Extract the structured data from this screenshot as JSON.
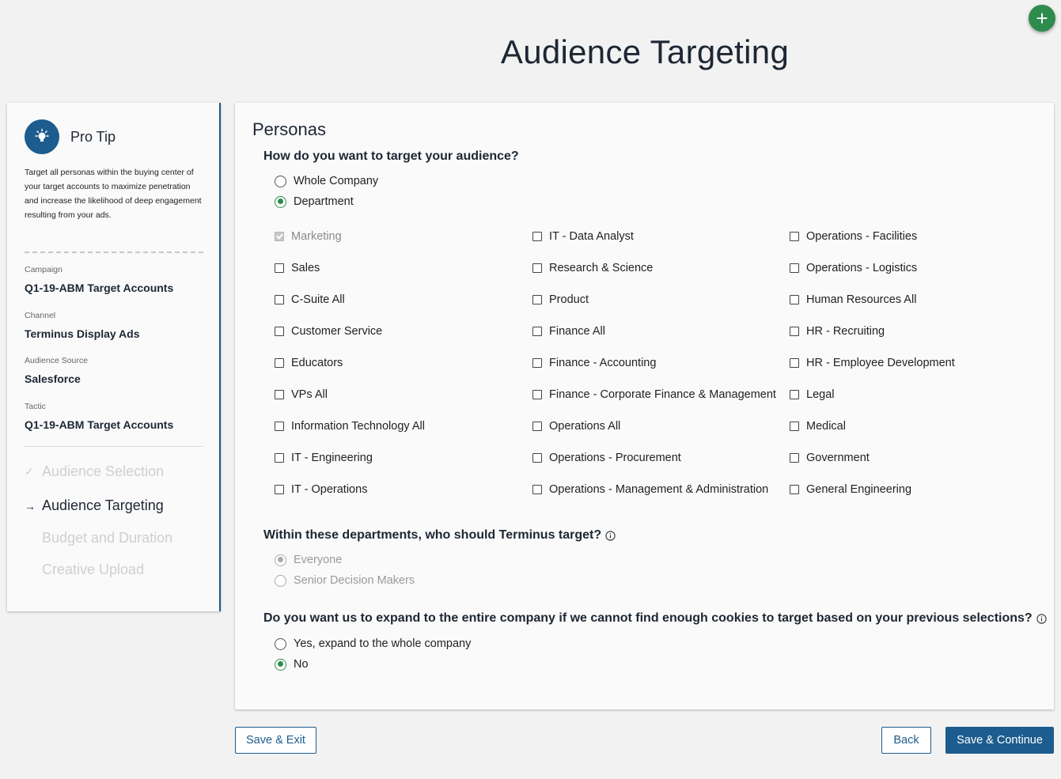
{
  "title": "Audience Targeting",
  "fab": {
    "icon": "plus-icon",
    "glyph": "+"
  },
  "sidebar": {
    "tip_title": "Pro Tip",
    "tip_icon": "lightbulb-icon",
    "tip_text": "Target all personas within the buying center of your target accounts to maximize penetration and increase the likelihood of deep engagement resulting from your ads.",
    "meta": [
      {
        "label": "Campaign",
        "value": "Q1-19-ABM Target Accounts"
      },
      {
        "label": "Channel",
        "value": "Terminus Display Ads"
      },
      {
        "label": "Audience Source",
        "value": "Salesforce"
      },
      {
        "label": "Tactic",
        "value": "Q1-19-ABM Target Accounts"
      }
    ],
    "steps": [
      {
        "label": "Audience Selection",
        "state": "done",
        "marker": "✓"
      },
      {
        "label": "Audience Targeting",
        "state": "active",
        "marker": "→"
      },
      {
        "label": "Budget and Duration",
        "state": "upcoming",
        "marker": ""
      },
      {
        "label": "Creative Upload",
        "state": "upcoming",
        "marker": ""
      }
    ]
  },
  "main": {
    "heading": "Personas",
    "q1": {
      "text": "How do you want to target your audience?",
      "options": [
        {
          "label": "Whole Company",
          "checked": false
        },
        {
          "label": "Department",
          "checked": true
        }
      ]
    },
    "departments": [
      [
        {
          "label": "Marketing",
          "checked": true,
          "disabled": true
        },
        {
          "label": "Sales"
        },
        {
          "label": "C-Suite All"
        },
        {
          "label": "Customer Service"
        },
        {
          "label": "Educators"
        },
        {
          "label": "VPs All"
        },
        {
          "label": "Information Technology All"
        },
        {
          "label": "IT - Engineering"
        },
        {
          "label": "IT - Operations"
        }
      ],
      [
        {
          "label": "IT - Data Analyst"
        },
        {
          "label": "Research & Science"
        },
        {
          "label": "Product"
        },
        {
          "label": "Finance All"
        },
        {
          "label": "Finance - Accounting"
        },
        {
          "label": "Finance - Corporate Finance & Management"
        },
        {
          "label": "Operations All"
        },
        {
          "label": "Operations - Procurement"
        },
        {
          "label": "Operations - Management & Administration"
        }
      ],
      [
        {
          "label": "Operations - Facilities"
        },
        {
          "label": "Operations - Logistics"
        },
        {
          "label": "Human Resources All"
        },
        {
          "label": "HR - Recruiting"
        },
        {
          "label": "HR - Employee Development"
        },
        {
          "label": "Legal"
        },
        {
          "label": "Medical"
        },
        {
          "label": "Government"
        },
        {
          "label": "General Engineering"
        }
      ]
    ],
    "q2": {
      "text": "Within these departments, who should Terminus target?",
      "options": [
        {
          "label": "Everyone",
          "checked": true,
          "disabled": true
        },
        {
          "label": "Senior Decision Makers",
          "checked": false,
          "disabled": true
        }
      ]
    },
    "q3": {
      "text": "Do you want us to expand to the entire company if we cannot find enough cookies to target based on your previous selections?",
      "options": [
        {
          "label": "Yes, expand to the whole company",
          "checked": false
        },
        {
          "label": "No",
          "checked": true
        }
      ]
    }
  },
  "buttons": {
    "save_exit": "Save & Exit",
    "back": "Back",
    "save_continue": "Save & Continue"
  },
  "colors": {
    "primary": "#1c5c8e",
    "success": "#2e8b4e"
  }
}
